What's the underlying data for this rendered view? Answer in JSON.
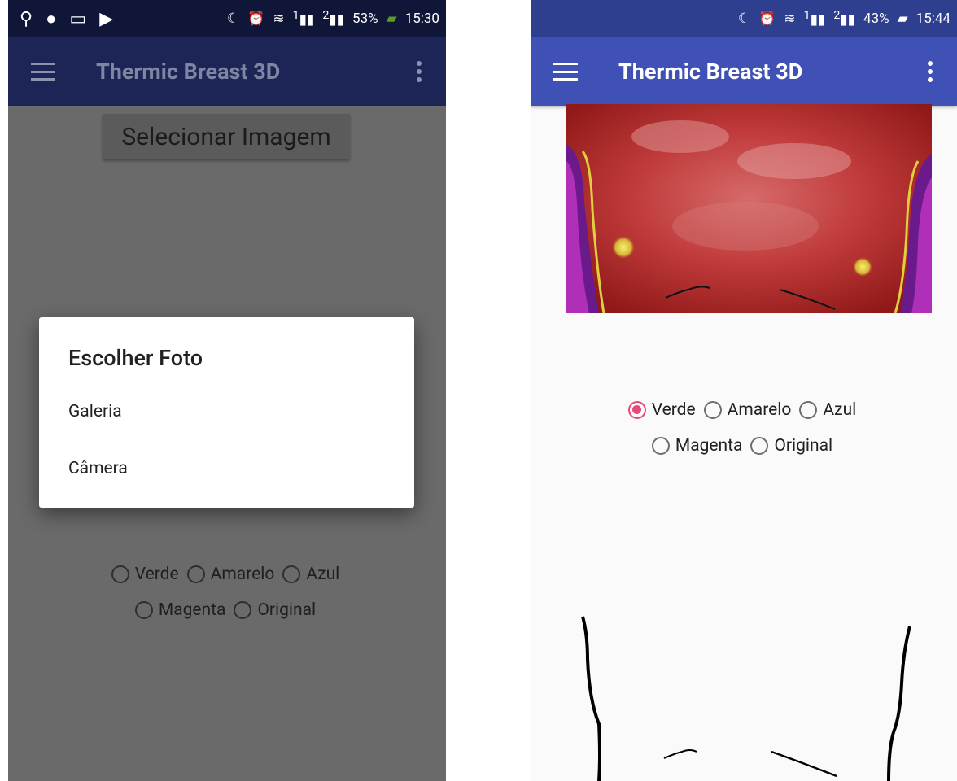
{
  "left": {
    "status": {
      "time": "15:30",
      "battery": "53%",
      "sim1": "1",
      "sim2": "2"
    },
    "app_title": "Thermic Breast 3D",
    "select_button": "Selecionar Imagem",
    "dialog": {
      "title": "Escolher Foto",
      "options": [
        "Galeria",
        "Câmera"
      ]
    },
    "radios_row1": [
      "Verde",
      "Amarelo",
      "Azul"
    ],
    "radios_row2": [
      "Magenta",
      "Original"
    ]
  },
  "right": {
    "status": {
      "time": "15:44",
      "battery": "43%",
      "sim1": "1",
      "sim2": "2"
    },
    "app_title": "Thermic Breast 3D",
    "radios_row1": [
      "Verde",
      "Amarelo",
      "Azul"
    ],
    "radios_row2": [
      "Magenta",
      "Original"
    ],
    "selected_color": "Verde"
  },
  "colors": {
    "appbar": "#3f51b5",
    "statusbar": "#2f3f8f",
    "accent": "#e64a7b",
    "dimmed_appbar": "#1c2556"
  }
}
